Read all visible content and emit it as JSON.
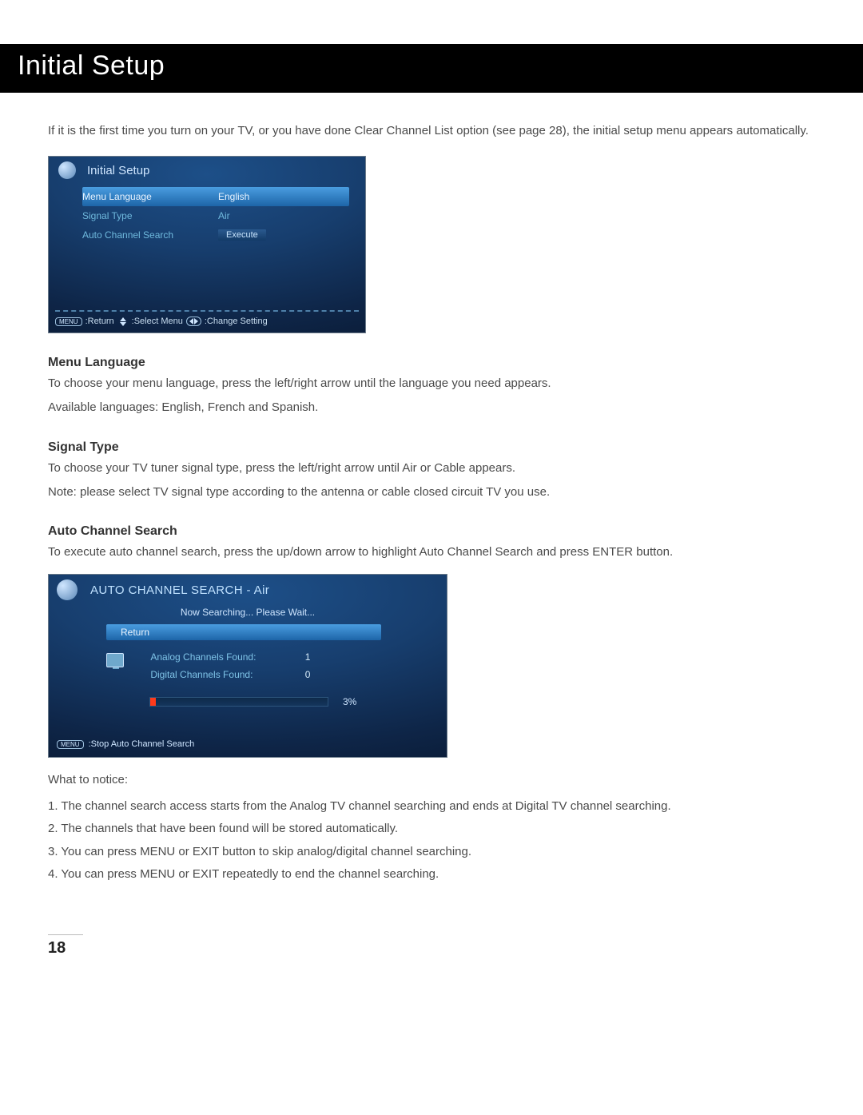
{
  "header": {
    "title": "Initial Setup"
  },
  "intro": "If it is the first time you turn on your TV, or you have done Clear Channel List option (see page 28), the initial setup menu appears automatically.",
  "tv1": {
    "title": "Initial Setup",
    "rows": [
      {
        "label": "Menu Language",
        "value": "English",
        "selected": true
      },
      {
        "label": "Signal Type",
        "value": "Air",
        "selected": false
      },
      {
        "label": "Auto Channel Search",
        "value": "Execute",
        "selected": false,
        "exec": true
      }
    ],
    "footer": {
      "menu_label": "MENU",
      "return": ":Return",
      "select_menu": ":Select Menu",
      "change_setting": ":Change Setting"
    }
  },
  "sections": {
    "menu_language": {
      "heading": "Menu Language",
      "p1": "To choose your menu language, press the left/right arrow until the language you need appears.",
      "p2": "Available languages: English, French and Spanish."
    },
    "signal_type": {
      "heading": "Signal Type",
      "p1": "To choose your TV tuner signal type, press the left/right arrow until Air or Cable appears.",
      "p2": "Note: please select TV signal type according to the antenna or cable closed circuit TV you use."
    },
    "auto_channel_search": {
      "heading": "Auto Channel Search",
      "p1": "To execute auto channel search, press the up/down arrow to highlight Auto Channel Search and press ENTER button."
    }
  },
  "tv2": {
    "title": "AUTO CHANNEL SEARCH - Air",
    "status": "Now Searching... Please Wait...",
    "return_label": "Return",
    "analog_label": "Analog Channels Found:",
    "analog_count": "1",
    "digital_label": "Digital Channels Found:",
    "digital_count": "0",
    "progress_percent": 3,
    "progress_text": "3%",
    "footer": {
      "menu_label": "MENU",
      "stop": ":Stop Auto Channel Search"
    }
  },
  "notice": {
    "heading": "What to notice:",
    "items": [
      "1. The channel search access starts from the Analog TV channel searching and ends at Digital TV channel searching.",
      "2. The channels that have been found will be stored automatically.",
      "3. You can press MENU or EXIT button to skip analog/digital channel searching.",
      "4. You can press MENU or EXIT repeatedly to end the channel searching."
    ]
  },
  "page_number": "18"
}
